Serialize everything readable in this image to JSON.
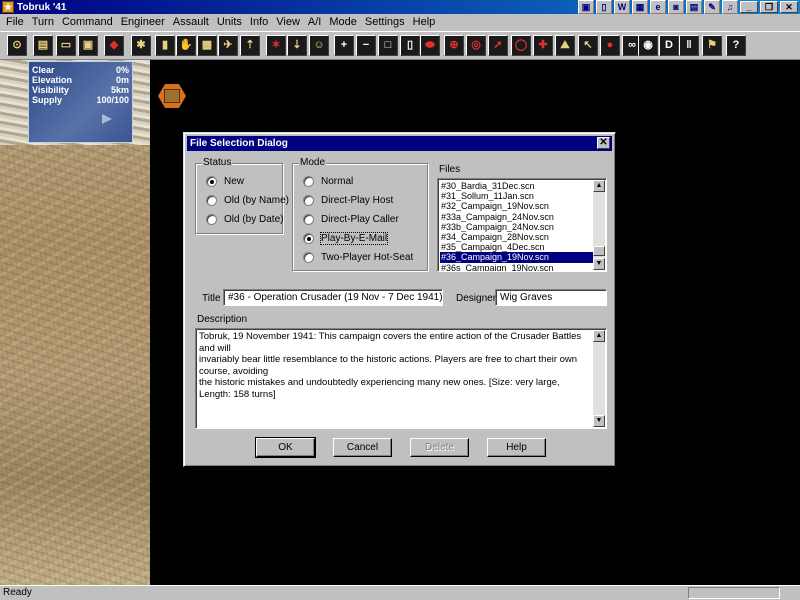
{
  "window": {
    "title": "Tobruk '41"
  },
  "menu": [
    "File",
    "Turn",
    "Command",
    "Engineer",
    "Assault",
    "Units",
    "Info",
    "View",
    "A/I",
    "Mode",
    "Settings",
    "Help"
  ],
  "toolbar_buttons": [
    {
      "name": "center-icon",
      "glyph": "⊙"
    },
    {
      "name": "new-file-icon",
      "glyph": "▤"
    },
    {
      "name": "open-file-icon",
      "glyph": "▭"
    },
    {
      "name": "save-file-icon",
      "glyph": "▣"
    },
    {
      "name": "fire-icon",
      "glyph": "◆"
    },
    {
      "name": "assault-icon",
      "glyph": "✱"
    },
    {
      "name": "unit-icon",
      "glyph": "▮"
    },
    {
      "name": "hand-icon",
      "glyph": "✋"
    },
    {
      "name": "supply-icon",
      "glyph": "▩"
    },
    {
      "name": "aircraft-icon",
      "glyph": "✈"
    },
    {
      "name": "arrow-up-icon",
      "glyph": "⇡"
    },
    {
      "name": "explosion-icon",
      "glyph": "✶"
    },
    {
      "name": "arrow-down-icon",
      "glyph": "⇣"
    },
    {
      "name": "leader-icon",
      "glyph": "☺"
    },
    {
      "name": "zoom-in-icon",
      "glyph": "+"
    },
    {
      "name": "zoom-out-icon",
      "glyph": "−"
    },
    {
      "name": "square-icon",
      "glyph": "□"
    },
    {
      "name": "card-icon",
      "glyph": "▯"
    },
    {
      "name": "oval-icon",
      "glyph": "⬬"
    },
    {
      "name": "crosshair-icon",
      "glyph": "⊕"
    },
    {
      "name": "target-icon",
      "glyph": "◎"
    },
    {
      "name": "red-arrow-icon",
      "glyph": "➚"
    },
    {
      "name": "ring-icon",
      "glyph": "◯"
    },
    {
      "name": "red-cross-icon",
      "glyph": "✚"
    },
    {
      "name": "terrain-icon",
      "glyph": "⛰"
    },
    {
      "name": "pointer-icon",
      "glyph": "↖"
    },
    {
      "name": "badge-icon",
      "glyph": "●"
    },
    {
      "name": "binoculars-icon",
      "glyph": "∞"
    },
    {
      "name": "eye-icon",
      "glyph": "◉"
    },
    {
      "name": "d-icon",
      "glyph": "D"
    },
    {
      "name": "pillar-icon",
      "glyph": "‖"
    },
    {
      "name": "flag-icon",
      "glyph": "⚑"
    },
    {
      "name": "help-icon",
      "glyph": "?"
    }
  ],
  "info_panel": {
    "weather": "Clear",
    "weather_value": "0%",
    "elevation_label": "Elevation",
    "elevation_value": "0m",
    "visibility_label": "Visibility",
    "visibility_value": "5km",
    "supply_label": "Supply",
    "supply_value": "100/100"
  },
  "dialog": {
    "title": "File Selection Dialog",
    "close_glyph": "✕",
    "status": {
      "label": "Status",
      "options": [
        "New",
        "Old (by Name)",
        "Old (by Date)"
      ],
      "selected": 0
    },
    "mode": {
      "label": "Mode",
      "options": [
        "Normal",
        "Direct-Play Host",
        "Direct-Play Caller",
        "Play-By-E-Mail",
        "Two-Player Hot-Seat"
      ],
      "selected": 3
    },
    "files": {
      "label": "Files",
      "items": [
        "#30_Bardia_31Dec.scn",
        "#31_Sollum_11Jan.scn",
        "#32_Campaign_19Nov.scn",
        "#33a_Campaign_24Nov.scn",
        "#33b_Campaign_24Nov.scn",
        "#34_Campaign_28Nov.scn",
        "#35_Campaign_4Dec.scn",
        "#36_Campaign_19Nov.scn",
        "#36s_Campaign_19Nov.scn"
      ],
      "selected": 7
    },
    "title_label": "Title",
    "title_value": "#36 - Operation Crusader (19 Nov - 7 Dec 1941)",
    "designer_label": "Designer",
    "designer_value": "Wig Graves",
    "description_label": "Description",
    "description_lines": [
      "Tobruk, 19 November 1941: This campaign covers the entire action of the Crusader Battles and will",
      "invariably bear little resemblance to the historic actions. Players are free to chart their own course, avoiding",
      "the historic mistakes and undoubtedly experiencing many new ones. [Size: very large, Length: 158 turns]"
    ],
    "buttons": {
      "ok": "OK",
      "cancel": "Cancel",
      "delete": "Delete",
      "help": "Help"
    }
  },
  "statusbar": {
    "text": "Ready"
  },
  "colors": {
    "selection": "#000080",
    "title_bar": "#000080",
    "map_background": "#000000",
    "dialog_face": "#c0c0c0"
  }
}
